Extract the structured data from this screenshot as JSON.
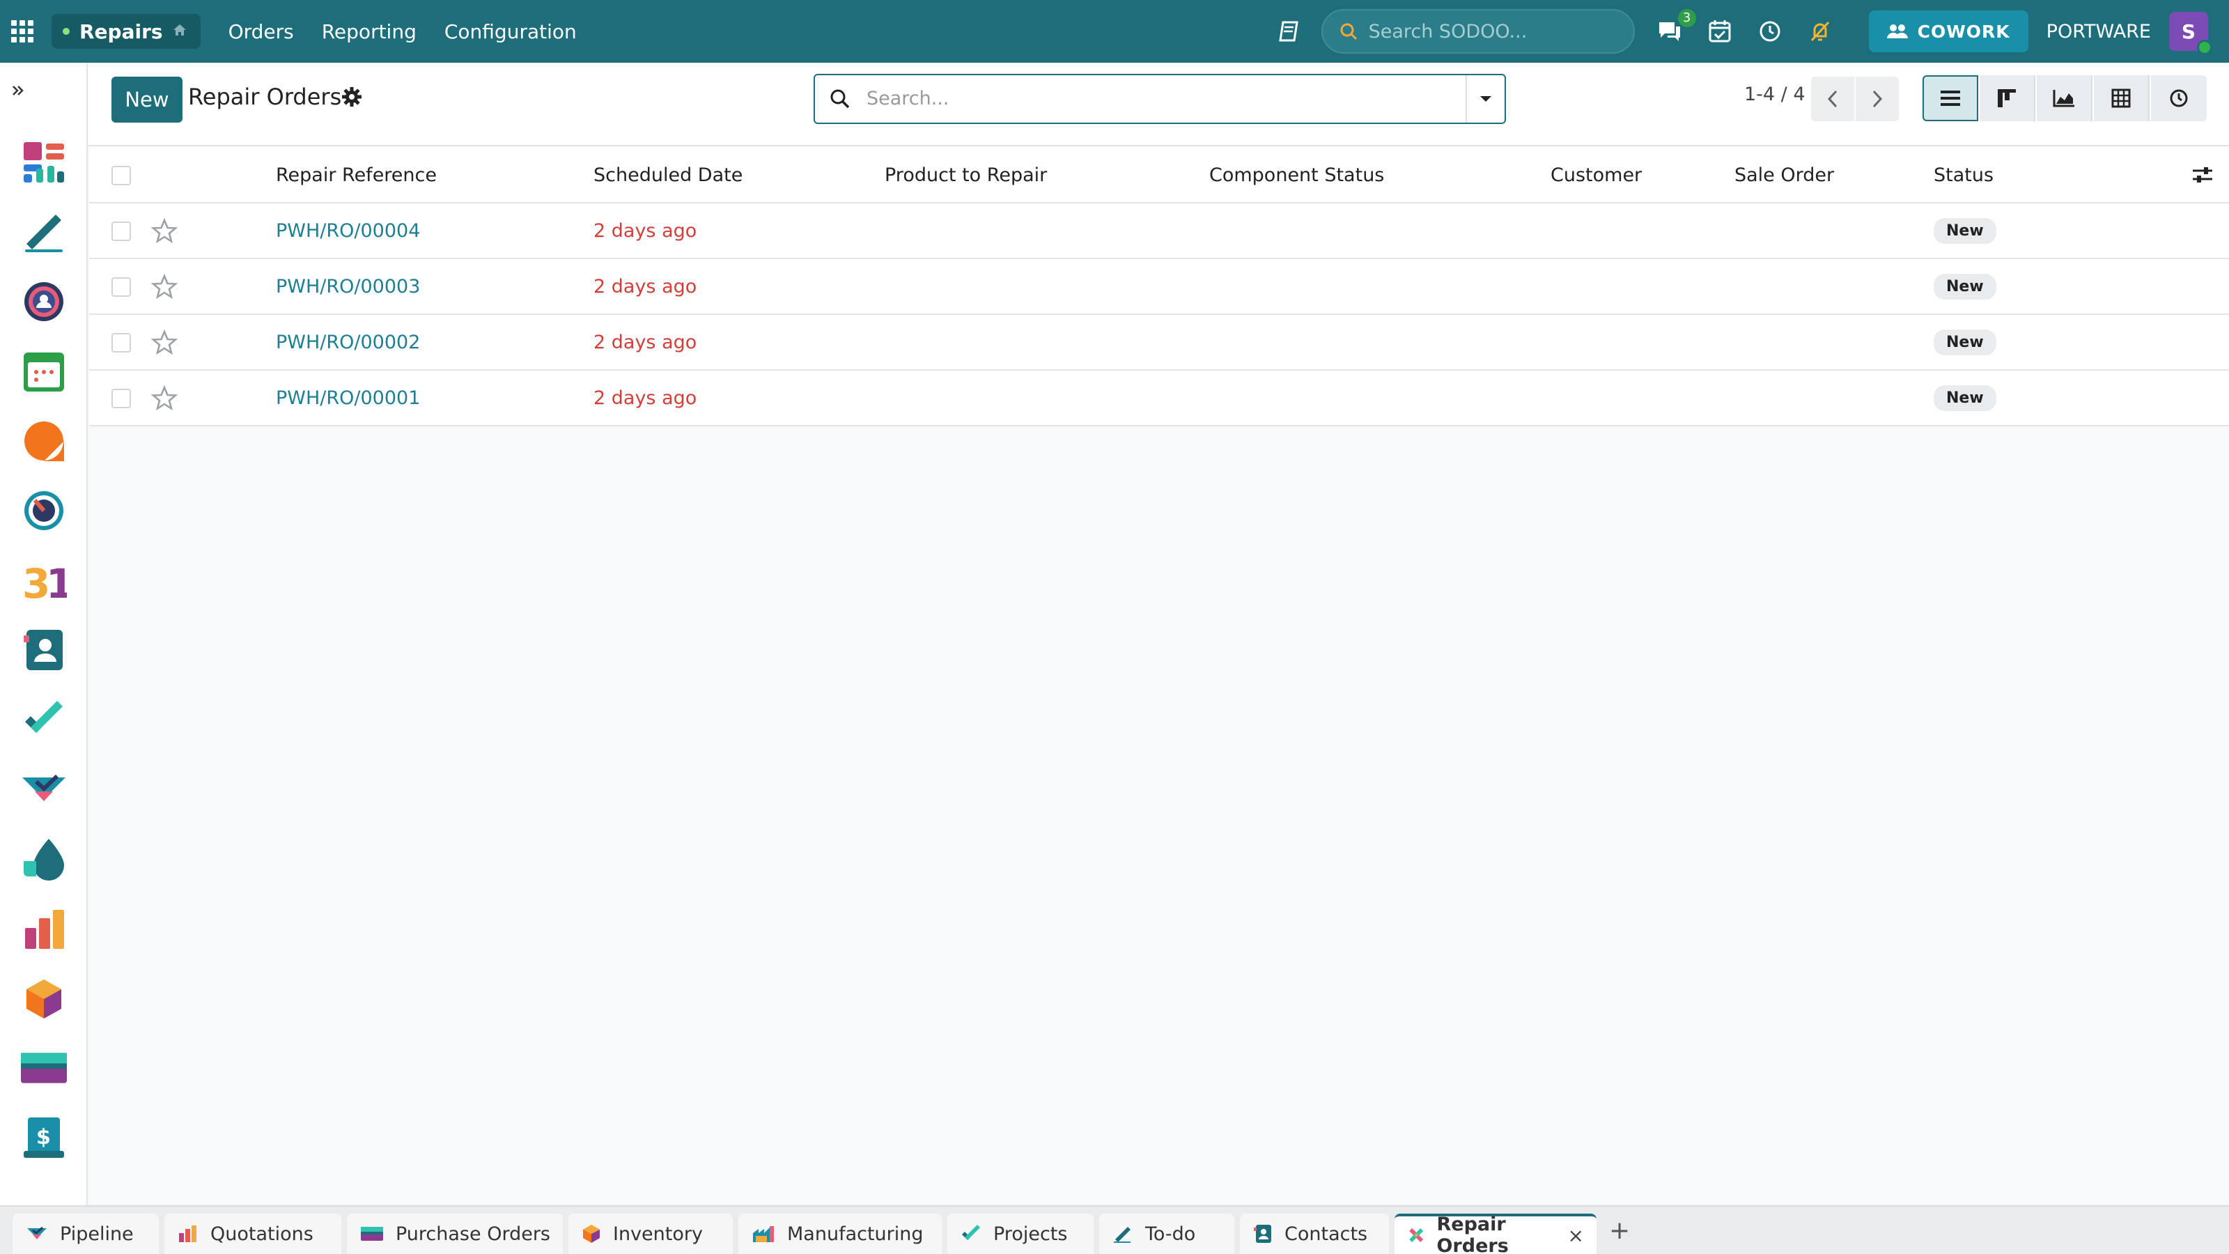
{
  "topbar": {
    "app_name": "Repairs",
    "menu": [
      "Orders",
      "Reporting",
      "Configuration"
    ],
    "search_placeholder": "Search SODOO...",
    "messages_count": "3",
    "cowork_label": "COWORK",
    "company": "PORTWARE",
    "avatar_letter": "S"
  },
  "control": {
    "new_label": "New",
    "title": "Repair Orders",
    "search_placeholder": "Search...",
    "pager": "1-4 / 4"
  },
  "table": {
    "columns": [
      "Repair Reference",
      "Scheduled Date",
      "Product to Repair",
      "Component Status",
      "Customer",
      "Sale Order",
      "Status"
    ],
    "rows": [
      {
        "ref": "PWH/RO/00004",
        "date": "2 days ago",
        "status": "New"
      },
      {
        "ref": "PWH/RO/00003",
        "date": "2 days ago",
        "status": "New"
      },
      {
        "ref": "PWH/RO/00002",
        "date": "2 days ago",
        "status": "New"
      },
      {
        "ref": "PWH/RO/00001",
        "date": "2 days ago",
        "status": "New"
      }
    ]
  },
  "tabs": [
    {
      "label": "Pipeline"
    },
    {
      "label": "Quotations"
    },
    {
      "label": "Purchase Orders"
    },
    {
      "label": "Inventory"
    },
    {
      "label": "Manufacturing"
    },
    {
      "label": "Projects"
    },
    {
      "label": "To-do"
    },
    {
      "label": "Contacts"
    },
    {
      "label": "Repair Orders"
    }
  ],
  "colors": {
    "brand": "#1d6e7a",
    "link": "#1c7f93",
    "overdue": "#d23f3a"
  }
}
